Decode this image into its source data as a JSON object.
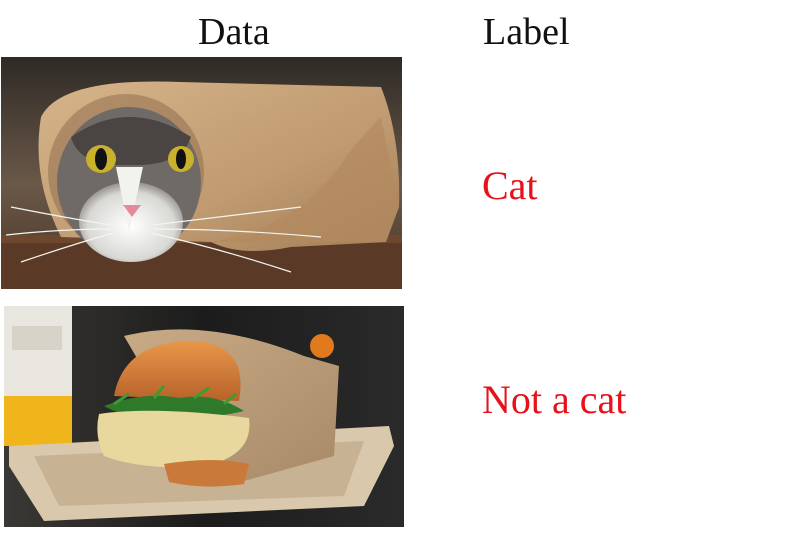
{
  "headers": {
    "data": "Data",
    "label": "Label"
  },
  "rows": [
    {
      "image": "cat-in-paper-photo",
      "label": "Cat"
    },
    {
      "image": "sandwich-in-paper-photo",
      "label": "Not a cat"
    }
  ],
  "colors": {
    "label": "#e8101a",
    "header": "#111111"
  }
}
